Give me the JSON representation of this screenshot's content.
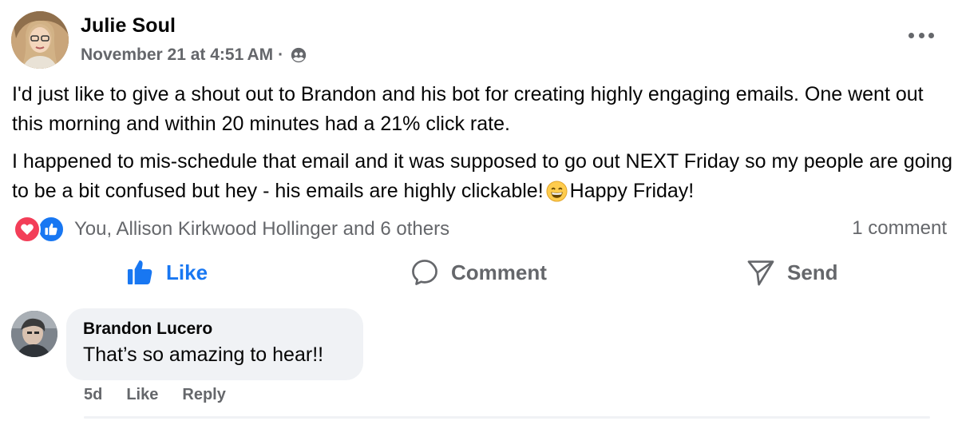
{
  "post": {
    "author": "Julie Soul",
    "timestamp": "November 21 at 4:51 AM",
    "separator": "·",
    "audience_icon": "friends-icon",
    "more_icon": "more-options-icon",
    "paragraphs": [
      "I'd just like to give a shout out to Brandon and his bot for creating highly engaging emails. One went out this morning and within 20 minutes had a 21% click rate.",
      "I happened to mis-schedule that email and it was supposed to go out NEXT Friday so my people are going to be a bit confused but hey - his emails are highly clickable!"
    ],
    "paragraph_end": "Happy Friday!",
    "emoji": "grinning-face-emoji"
  },
  "reactions": {
    "icons": [
      "love-reaction-icon",
      "like-reaction-icon"
    ],
    "summary": "You, Allison Kirkwood Hollinger and 6 others",
    "comment_count": "1 comment",
    "love_color": "#f33e58",
    "like_color": "#1877f2"
  },
  "actions": {
    "like": "Like",
    "comment": "Comment",
    "send": "Send",
    "active_color": "#1877f2"
  },
  "comment": {
    "author": "Brandon Lucero",
    "text": "That’s so amazing to hear!!",
    "age": "5d",
    "like": "Like",
    "reply": "Reply"
  }
}
